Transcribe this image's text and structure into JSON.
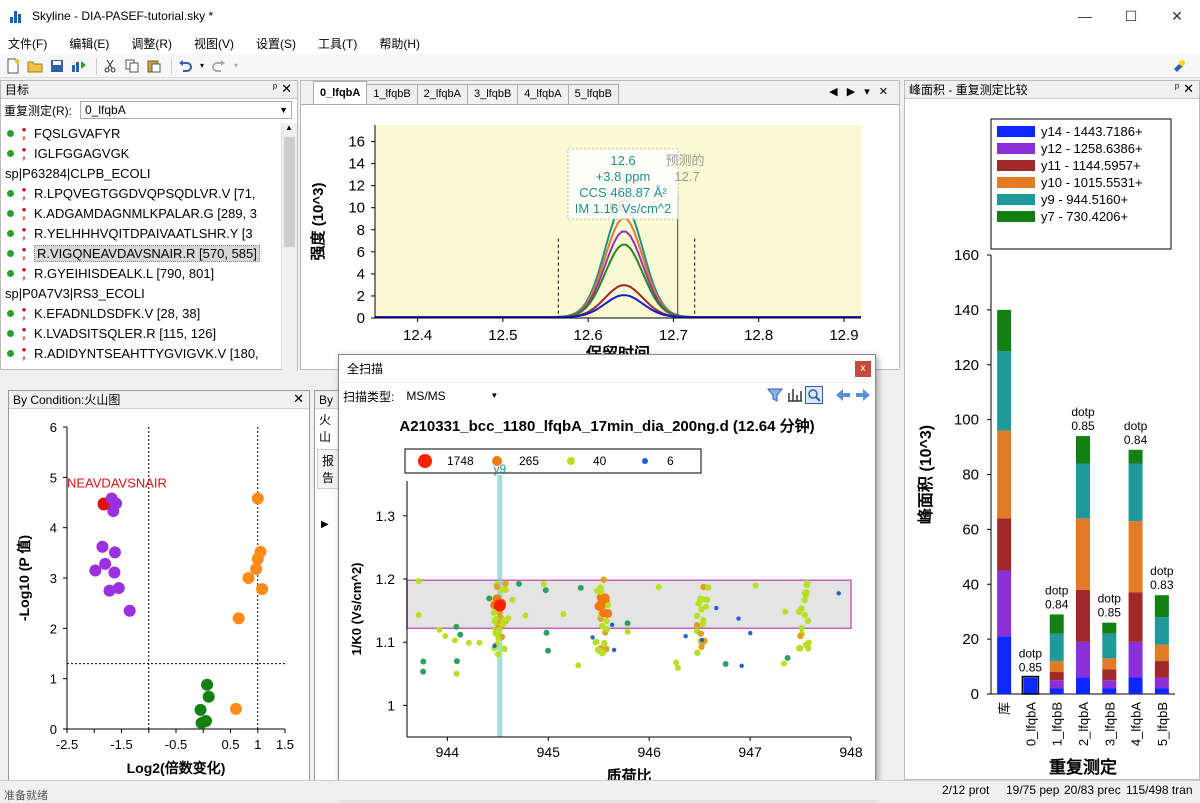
{
  "window": {
    "title": "Skyline - DIA-PASEF-tutorial.sky *",
    "min": "—",
    "max": "☐",
    "close": "✕"
  },
  "menu": [
    "文件(F)",
    "编辑(E)",
    "调整(R)",
    "视图(V)",
    "设置(S)",
    "工具(T)",
    "帮助(H)"
  ],
  "targets": {
    "title": "目标",
    "replicate_label": "重复测定(R):",
    "replicate_value": "0_lfqbA",
    "rows": [
      {
        "type": "pep",
        "text": "FQSLGVAFYR"
      },
      {
        "type": "pep",
        "text": "IGLFGGAGVGK"
      },
      {
        "type": "prot",
        "text": "sp|P63284|CLPB_ECOLI"
      },
      {
        "type": "pep",
        "text": "R.LPQVEGTGGDVQPSQDLVR.V [71,"
      },
      {
        "type": "pep",
        "text": "K.ADGAMDAGNMLKPALAR.G [289, 3"
      },
      {
        "type": "pep",
        "text": "R.YELHHHVQITDPAIVAATLSHR.Y [3"
      },
      {
        "type": "pep",
        "text": "R.VIGQNEAVDAVSNAIR.R [570, 585]",
        "selected": true
      },
      {
        "type": "pep",
        "text": "R.GYEIHISDEALK.L [790, 801]"
      },
      {
        "type": "prot",
        "text": "sp|P0A7V3|RS3_ECOLI"
      },
      {
        "type": "pep",
        "text": "K.EFADNLDSDFK.V [28, 38]"
      },
      {
        "type": "pep",
        "text": "K.LVADSITSQLER.R [115, 126]"
      },
      {
        "type": "pep",
        "text": "R.ADIDYNTSEAHTTYGVIGVK.V [180,"
      }
    ]
  },
  "chromatogram": {
    "tabs": [
      "0_lfqbA",
      "1_lfqbB",
      "2_lfqbA",
      "3_lfqbB",
      "4_lfqbA",
      "5_lfqbB"
    ],
    "active_tab": 0,
    "nav": "◀ ▶ ▾ ✕",
    "tooltip": [
      "12.6",
      "+3.8 ppm",
      "CCS 468.87 Å²",
      "IM 1.16 Vs/cm^2"
    ],
    "predicted_label": "预测的",
    "predicted_value": "12.7",
    "chart_data": {
      "type": "line",
      "xlabel": "保留时间",
      "ylabel": "强度 (10^3)",
      "xlim": [
        12.35,
        12.92
      ],
      "ylim": [
        0,
        17.5
      ],
      "xticks": [
        "12.4",
        "12.5",
        "12.6",
        "12.7",
        "12.8",
        "12.9"
      ],
      "yticks": [
        "0",
        "2",
        "4",
        "6",
        "8",
        "10",
        "12",
        "14",
        "16"
      ],
      "series": [
        {
          "color": "#1f8f8f",
          "peak": 10.2
        },
        {
          "color": "#e07b28",
          "peak": 9.0
        },
        {
          "color": "#9b30b8",
          "peak": 7.8
        },
        {
          "color": "#1f8a1f",
          "peak": 6.6
        },
        {
          "color": "#a12828",
          "peak": 2.9
        },
        {
          "color": "#1a1ad0",
          "peak": 2.0
        }
      ]
    }
  },
  "peak_areas": {
    "title": "峰面积 - 重复测定比较",
    "legend": [
      "y14 - 1443.7186+",
      "y12 - 1258.6386+",
      "y11 - 1144.5957+",
      "y10 - 1015.5531+",
      "y9 - 944.5160+",
      "y7 - 730.4206+"
    ],
    "colors": [
      "#0a28ff",
      "#8a30d8",
      "#a12828",
      "#e07b28",
      "#1f9999",
      "#128012"
    ],
    "chart_data": {
      "type": "bar",
      "stacked": true,
      "xlabel": "重复测定",
      "ylabel": "峰面积 (10^3)",
      "ylim": [
        0,
        160
      ],
      "yticks": [
        "0",
        "20",
        "40",
        "60",
        "80",
        "100",
        "120",
        "140",
        "160"
      ],
      "categories": [
        "库",
        "0_lfqbA",
        "1_lfqbB",
        "2_lfqbA",
        "3_lfqbB",
        "4_lfqbA",
        "5_lfqbB"
      ],
      "dotp": [
        "",
        "0.85",
        "0.84",
        "0.85",
        "0.85",
        "0.84",
        "0.83"
      ],
      "dotp_label": "dotp",
      "stacks": [
        [
          21,
          24,
          19,
          32,
          29,
          15
        ],
        [
          6,
          0,
          0,
          0,
          0,
          0
        ],
        [
          2,
          3,
          3,
          4,
          10,
          7
        ],
        [
          6,
          13,
          19,
          26,
          20,
          10
        ],
        [
          2,
          3,
          4,
          4,
          9,
          4
        ],
        [
          6,
          13,
          18,
          26,
          21,
          5
        ],
        [
          2,
          4,
          6,
          6,
          10,
          8
        ]
      ]
    }
  },
  "volcano": {
    "title": "By Condition:火山图",
    "annotation": "NEAVDAVSNAIR",
    "chart_data": {
      "type": "scatter",
      "xlabel": "Log2(倍数变化)",
      "ylabel": "-Log10 (P 值)",
      "xlim": [
        -2.5,
        1.5
      ],
      "ylim": [
        0,
        6
      ],
      "xticks": [
        "-2.5",
        "-2",
        "-1.5",
        "-1",
        "-0.5",
        "0",
        "0.5",
        "1",
        "1.5"
      ],
      "yticks": [
        "0",
        "1",
        "2",
        "3",
        "4",
        "5",
        "6"
      ],
      "series": [
        {
          "color": "#e01010",
          "points": [
            [
              -1.82,
              4.47
            ]
          ]
        },
        {
          "color": "#9b30e0",
          "points": [
            [
              -1.68,
              4.58
            ],
            [
              -1.6,
              4.48
            ],
            [
              -1.65,
              4.33
            ],
            [
              -1.85,
              3.62
            ],
            [
              -1.62,
              3.51
            ],
            [
              -1.8,
              3.28
            ],
            [
              -1.98,
              3.15
            ],
            [
              -1.63,
              3.11
            ],
            [
              -1.55,
              2.8
            ],
            [
              -1.72,
              2.75
            ],
            [
              -1.35,
              2.35
            ]
          ]
        },
        {
          "color": "#ff8a1a",
          "points": [
            [
              1.0,
              4.58
            ],
            [
              1.05,
              3.52
            ],
            [
              1.0,
              3.38
            ],
            [
              0.97,
              3.18
            ],
            [
              0.83,
              3.0
            ],
            [
              1.08,
              2.78
            ],
            [
              0.65,
              2.2
            ],
            [
              0.6,
              0.4
            ]
          ]
        },
        {
          "color": "#128012",
          "points": [
            [
              0.07,
              0.88
            ],
            [
              0.1,
              0.64
            ],
            [
              -0.05,
              0.38
            ],
            [
              0.05,
              0.16
            ],
            [
              -0.03,
              0.12
            ]
          ]
        }
      ]
    }
  },
  "byc2": {
    "title": "By",
    "line1": "火山",
    "line2": "报告"
  },
  "fullscan": {
    "title": "全扫描",
    "scan_type_label": "扫描类型:",
    "scan_type_value": "MS/MS",
    "close": "x",
    "heading": "A210331_bcc_1180_lfqbA_17min_dia_200ng.d (12.64 分钟)",
    "legend": [
      "1748",
      "265",
      "40",
      "6"
    ],
    "legend_colors": [
      "#ff2000",
      "#f07a10",
      "#b8e020",
      "#2060d0"
    ],
    "ion_label": "y9",
    "chart_data": {
      "type": "heatmap",
      "xlabel": "质荷比",
      "ylabel": "1/K0 (Vs/cm^2)",
      "xlim": [
        943.6,
        948.0
      ],
      "ylim": [
        0.95,
        1.355
      ],
      "xticks": [
        "944",
        "945",
        "946",
        "947",
        "948"
      ],
      "yticks": [
        "1",
        "1.1",
        "1.2",
        "1.3"
      ],
      "im_window": [
        1.122,
        1.198
      ],
      "clusters_mz": [
        944.52,
        945.53,
        946.53,
        947.53
      ]
    }
  },
  "status": {
    "left": "准备就绪",
    "prot": "2/12 prot",
    "pep": "19/75 pep",
    "prec": "20/83 prec",
    "tran": "115/498 tran"
  }
}
